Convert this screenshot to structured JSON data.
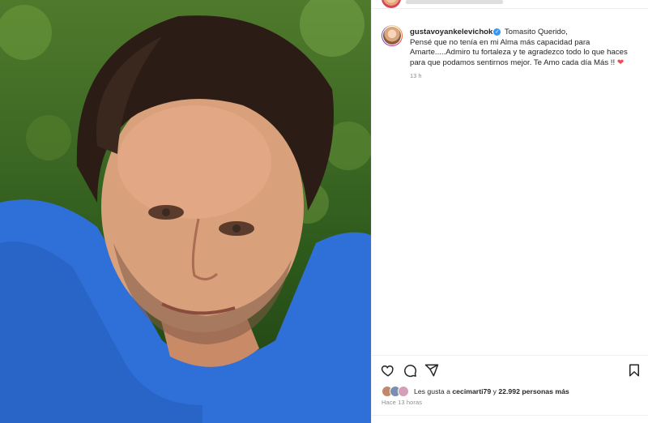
{
  "post": {
    "username": "gustavoyankelevichok",
    "caption_lines": [
      "Tomasito Querido,",
      "Pensé que no tenía en mi Alma más capacidad para",
      "Amarte.....Admiro tu fortaleza y te agradezco todo lo que haces",
      "para que podamos sentirnos mejor. Te Amo cada día Más !!"
    ],
    "heart_emoji": "❤",
    "time_ago": "13 h"
  },
  "likes": {
    "prefix": "Les gusta a ",
    "user": "cecimarti79",
    "middle": " y ",
    "count": "22.992 personas más"
  },
  "date_label": "Hace 13 horas",
  "icons": {
    "like": "heart-outline-icon",
    "comment": "comment-icon",
    "share": "paper-plane-icon",
    "save": "bookmark-icon"
  },
  "colors": {
    "verified": "#3897f0",
    "heart": "#ed4956",
    "shirt": "#2f6fd8",
    "muted_text": "#8e8e8e"
  }
}
